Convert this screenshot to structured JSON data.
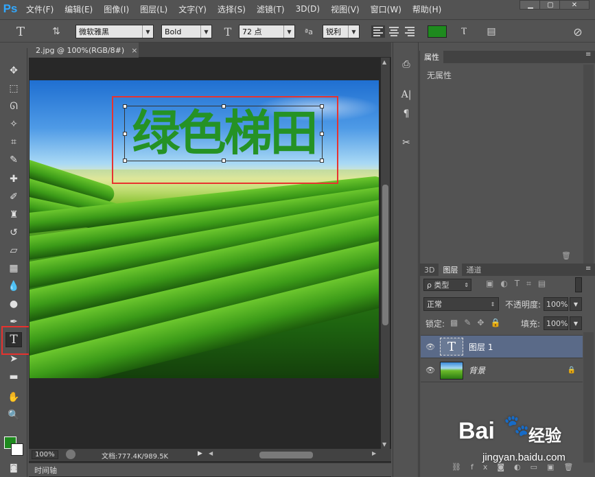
{
  "app": {
    "logo": "Ps"
  },
  "menu": [
    "文件(F)",
    "编辑(E)",
    "图像(I)",
    "图层(L)",
    "文字(Y)",
    "选择(S)",
    "滤镜(T)",
    "3D(D)",
    "视图(V)",
    "窗口(W)",
    "帮助(H)"
  ],
  "window_controls": {
    "minimize": "▁",
    "maximize": "▢",
    "close": "✕"
  },
  "options": {
    "font_family": "微软雅黑",
    "font_style": "Bold",
    "font_size": "72 点",
    "aa_icon_text": "ªa",
    "anti_alias": "锐利",
    "text_color": "#1e8a1e"
  },
  "document": {
    "tab_label": "2.jpg @ 100%(RGB/8#)",
    "tab_close": "×",
    "canvas_text": "绿色梯田",
    "canvas_text_color": "#259225",
    "zoom": "100%",
    "doc_size": "文档:777.4K/989.5K"
  },
  "timeline_label": "时间轴",
  "properties": {
    "tab": "属性",
    "empty_text": "无属性"
  },
  "layers_panel": {
    "tabs": [
      "3D",
      "图层",
      "通道"
    ],
    "filter_kind": "ρ 类型",
    "blend_mode": "正常",
    "opacity_label": "不透明度:",
    "opacity_value": "100%",
    "lock_label": "锁定:",
    "fill_label": "填充:",
    "fill_value": "100%",
    "layers": [
      {
        "name": "图层 1",
        "type": "text",
        "thumb_text": "T",
        "selected": true
      },
      {
        "name": "背景",
        "type": "image",
        "selected": false,
        "locked": true
      }
    ]
  },
  "watermark": {
    "brand": "Bai",
    "brand2": "经验",
    "url": "jingyan.baidu.com"
  }
}
